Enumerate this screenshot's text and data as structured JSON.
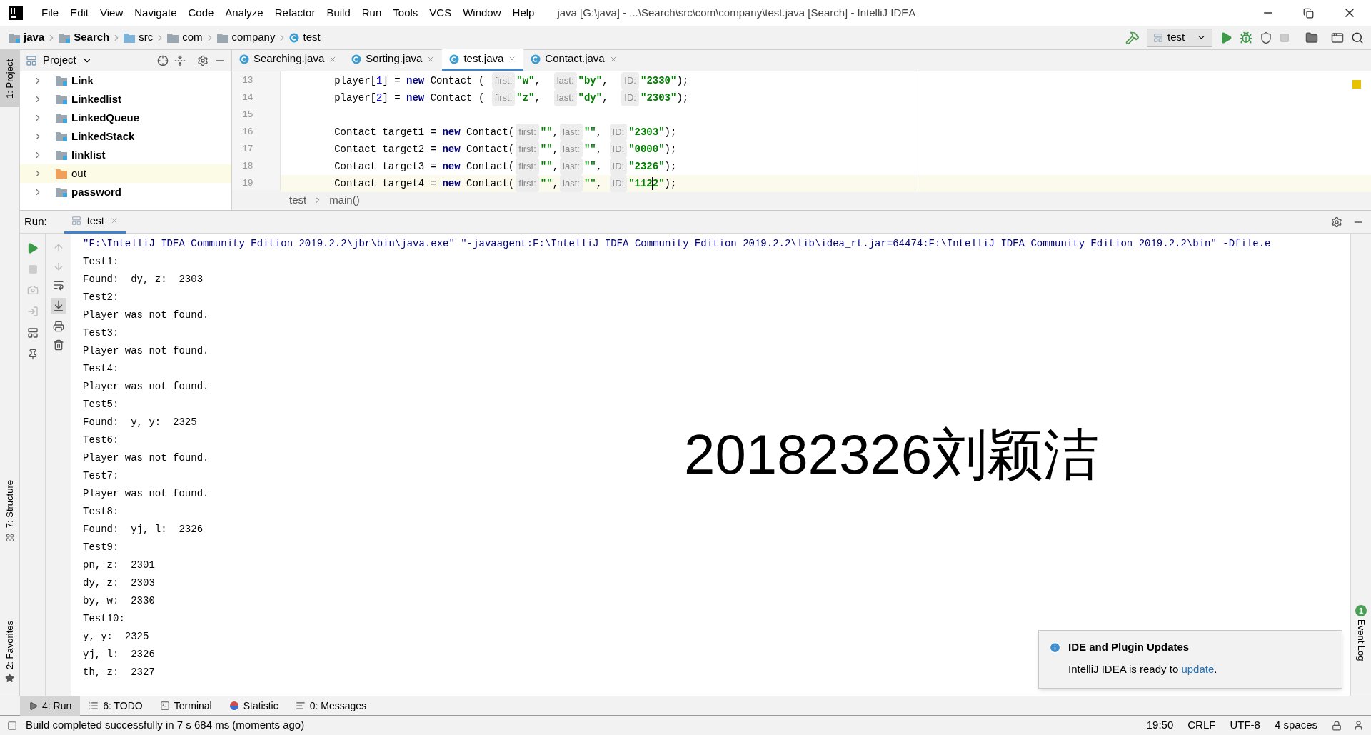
{
  "window": {
    "title": "java [G:\\java] - ...\\Search\\src\\com\\company\\test.java [Search] - IntelliJ IDEA"
  },
  "menu": [
    "File",
    "Edit",
    "View",
    "Navigate",
    "Code",
    "Analyze",
    "Refactor",
    "Build",
    "Run",
    "Tools",
    "VCS",
    "Window",
    "Help"
  ],
  "breadcrumbs": [
    {
      "label": "java",
      "kind": "module"
    },
    {
      "label": "Search",
      "kind": "module"
    },
    {
      "label": "src",
      "kind": "source"
    },
    {
      "label": "com",
      "kind": "package"
    },
    {
      "label": "company",
      "kind": "package"
    },
    {
      "label": "test",
      "kind": "class"
    }
  ],
  "run_config": "test",
  "left_stripe": {
    "project": "1: Project",
    "structure": "7: Structure",
    "favorites": "2: Favorites"
  },
  "project_panel": {
    "title": "Project",
    "items": [
      {
        "label": "Link",
        "kind": "module",
        "selected": false
      },
      {
        "label": "Linkedlist",
        "kind": "module",
        "selected": false
      },
      {
        "label": "LinkedQueue",
        "kind": "module",
        "selected": false
      },
      {
        "label": "LinkedStack",
        "kind": "module",
        "selected": false
      },
      {
        "label": "linklist",
        "kind": "module",
        "selected": false
      },
      {
        "label": "out",
        "kind": "excluded",
        "selected": true
      },
      {
        "label": "password",
        "kind": "module",
        "selected": false
      }
    ]
  },
  "editor_tabs": [
    {
      "label": "Searching.java",
      "selected": false
    },
    {
      "label": "Sorting.java",
      "selected": false
    },
    {
      "label": "test.java",
      "selected": true
    },
    {
      "label": "Contact.java",
      "selected": false
    }
  ],
  "code": [
    {
      "number": "13",
      "current": false,
      "tokens": [
        {
          "text": "        player[",
          "kind": "plain"
        },
        {
          "text": "1",
          "kind": "num"
        },
        {
          "text": "] = ",
          "kind": "plain"
        },
        {
          "text": "new",
          "kind": "kw"
        },
        {
          "text": " Contact ( ",
          "kind": "plain"
        },
        {
          "text": "first:",
          "kind": "hint"
        },
        {
          "text": "\"w\"",
          "kind": "str"
        },
        {
          "text": ",  ",
          "kind": "plain"
        },
        {
          "text": "last:",
          "kind": "hint"
        },
        {
          "text": "\"by\"",
          "kind": "str"
        },
        {
          "text": ",  ",
          "kind": "plain"
        },
        {
          "text": "ID:",
          "kind": "hint"
        },
        {
          "text": "\"2330\"",
          "kind": "str"
        },
        {
          "text": ");",
          "kind": "plain"
        }
      ]
    },
    {
      "number": "14",
      "current": false,
      "tokens": [
        {
          "text": "        player[",
          "kind": "plain"
        },
        {
          "text": "2",
          "kind": "num"
        },
        {
          "text": "] = ",
          "kind": "plain"
        },
        {
          "text": "new",
          "kind": "kw"
        },
        {
          "text": " Contact ( ",
          "kind": "plain"
        },
        {
          "text": "first:",
          "kind": "hint"
        },
        {
          "text": "\"z\"",
          "kind": "str"
        },
        {
          "text": ",  ",
          "kind": "plain"
        },
        {
          "text": "last:",
          "kind": "hint"
        },
        {
          "text": "\"dy\"",
          "kind": "str"
        },
        {
          "text": ",  ",
          "kind": "plain"
        },
        {
          "text": "ID:",
          "kind": "hint"
        },
        {
          "text": "\"2303\"",
          "kind": "str"
        },
        {
          "text": ");",
          "kind": "plain"
        }
      ]
    },
    {
      "number": "15",
      "current": false
    },
    {
      "number": "16",
      "current": false,
      "tokens": [
        {
          "text": "        Contact target1 = ",
          "kind": "plain"
        },
        {
          "text": "new",
          "kind": "kw"
        },
        {
          "text": " Contact(",
          "kind": "plain"
        },
        {
          "text": "first:",
          "kind": "hint"
        },
        {
          "text": "\"\"",
          "kind": "str"
        },
        {
          "text": ",",
          "kind": "plain"
        },
        {
          "text": "last:",
          "kind": "hint"
        },
        {
          "text": "\"\"",
          "kind": "str"
        },
        {
          "text": ", ",
          "kind": "plain"
        },
        {
          "text": "ID:",
          "kind": "hint"
        },
        {
          "text": "\"2303\"",
          "kind": "str"
        },
        {
          "text": ");",
          "kind": "plain"
        }
      ]
    },
    {
      "number": "17",
      "current": false,
      "tokens": [
        {
          "text": "        Contact target2 = ",
          "kind": "plain"
        },
        {
          "text": "new",
          "kind": "kw"
        },
        {
          "text": " Contact(",
          "kind": "plain"
        },
        {
          "text": "first:",
          "kind": "hint"
        },
        {
          "text": "\"\"",
          "kind": "str"
        },
        {
          "text": ",",
          "kind": "plain"
        },
        {
          "text": "last:",
          "kind": "hint"
        },
        {
          "text": "\"\"",
          "kind": "str"
        },
        {
          "text": ", ",
          "kind": "plain"
        },
        {
          "text": "ID:",
          "kind": "hint"
        },
        {
          "text": "\"0000\"",
          "kind": "str"
        },
        {
          "text": ");",
          "kind": "plain"
        }
      ]
    },
    {
      "number": "18",
      "current": false,
      "tokens": [
        {
          "text": "        Contact target3 = ",
          "kind": "plain"
        },
        {
          "text": "new",
          "kind": "kw"
        },
        {
          "text": " Contact(",
          "kind": "plain"
        },
        {
          "text": "first:",
          "kind": "hint"
        },
        {
          "text": "\"\"",
          "kind": "str"
        },
        {
          "text": ",",
          "kind": "plain"
        },
        {
          "text": "last:",
          "kind": "hint"
        },
        {
          "text": "\"\"",
          "kind": "str"
        },
        {
          "text": ", ",
          "kind": "plain"
        },
        {
          "text": "ID:",
          "kind": "hint"
        },
        {
          "text": "\"2326\"",
          "kind": "str"
        },
        {
          "text": ");",
          "kind": "plain"
        }
      ]
    },
    {
      "number": "19",
      "current": true,
      "tokens": [
        {
          "text": "        Contact target4 = ",
          "kind": "plain"
        },
        {
          "text": "new",
          "kind": "kw"
        },
        {
          "text": " Contact(",
          "kind": "plain"
        },
        {
          "text": "first:",
          "kind": "hint"
        },
        {
          "text": "\"\"",
          "kind": "str"
        },
        {
          "text": ",",
          "kind": "plain"
        },
        {
          "text": "last:",
          "kind": "hint"
        },
        {
          "text": "\"\"",
          "kind": "str"
        },
        {
          "text": ", ",
          "kind": "plain"
        },
        {
          "text": "ID:",
          "kind": "hint"
        },
        {
          "text": "\"1122\"",
          "kind": "str"
        },
        {
          "text": ");",
          "kind": "plain"
        }
      ]
    }
  ],
  "editor_breadcrumbs": [
    "test",
    "main()"
  ],
  "run_panel": {
    "label": "Run:",
    "tab": "test",
    "output": [
      {
        "text": "\"F:\\IntelliJ IDEA Community Edition 2019.2.2\\jbr\\bin\\java.exe\" \"-javaagent:F:\\IntelliJ IDEA Community Edition 2019.2.2\\lib\\idea_rt.jar=64474:F:\\IntelliJ IDEA Community Edition 2019.2.2\\bin\" -Dfile.e",
        "kind": "command"
      },
      {
        "text": "Test1:",
        "kind": "out"
      },
      {
        "text": "Found:  dy, z:  2303",
        "kind": "out"
      },
      {
        "text": "Test2:",
        "kind": "out"
      },
      {
        "text": "Player was not found.",
        "kind": "out"
      },
      {
        "text": "Test3:",
        "kind": "out"
      },
      {
        "text": "Player was not found.",
        "kind": "out"
      },
      {
        "text": "Test4:",
        "kind": "out"
      },
      {
        "text": "Player was not found.",
        "kind": "out"
      },
      {
        "text": "Test5:",
        "kind": "out"
      },
      {
        "text": "Found:  y, y:  2325",
        "kind": "out"
      },
      {
        "text": "Test6:",
        "kind": "out"
      },
      {
        "text": "Player was not found.",
        "kind": "out"
      },
      {
        "text": "Test7:",
        "kind": "out"
      },
      {
        "text": "Player was not found.",
        "kind": "out"
      },
      {
        "text": "Test8:",
        "kind": "out"
      },
      {
        "text": "Found:  yj, l:  2326",
        "kind": "out"
      },
      {
        "text": "Test9:",
        "kind": "out"
      },
      {
        "text": "pn, z:  2301",
        "kind": "out"
      },
      {
        "text": "dy, z:  2303",
        "kind": "out"
      },
      {
        "text": "by, w:  2330",
        "kind": "out"
      },
      {
        "text": "Test10:",
        "kind": "out"
      },
      {
        "text": "y, y:  2325",
        "kind": "out"
      },
      {
        "text": "yj, l:  2326",
        "kind": "out"
      },
      {
        "text": "th, z:  2327",
        "kind": "out"
      }
    ]
  },
  "overlay_text": "20182326刘颖洁",
  "notification": {
    "title": "IDE and Plugin Updates",
    "text_before": "IntelliJ IDEA is ready to ",
    "link": "update",
    "text_after": "."
  },
  "right_stripe": {
    "event_log": "Event Log",
    "badge": "1"
  },
  "bottom_tabs": [
    {
      "label": "4: Run",
      "kind": "run",
      "selected": true
    },
    {
      "label": "6: TODO",
      "kind": "todo",
      "selected": false
    },
    {
      "label": "Terminal",
      "kind": "terminal",
      "selected": false
    },
    {
      "label": "Statistic",
      "kind": "statistic",
      "selected": false
    },
    {
      "label": "0: Messages",
      "kind": "messages",
      "selected": false
    }
  ],
  "status_bar": {
    "message": "Build completed successfully in 7 s 684 ms (moments ago)",
    "position": "19:50",
    "line_separator": "CRLF",
    "encoding": "UTF-8",
    "indent": "4 spaces"
  }
}
